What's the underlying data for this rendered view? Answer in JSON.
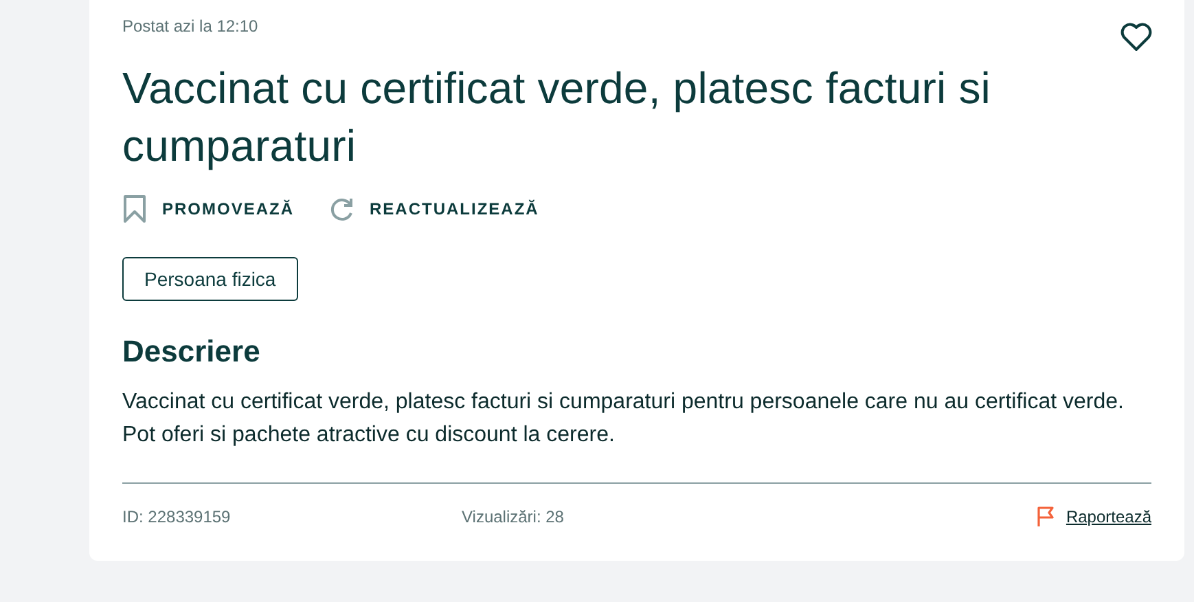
{
  "posted": "Postat azi la 12:10",
  "title": "Vaccinat cu certificat verde, platesc facturi si cumparaturi",
  "actions": [
    {
      "kind": "promote",
      "label": "PROMOVEAZĂ"
    },
    {
      "kind": "refresh",
      "label": "REACTUALIZEAZĂ"
    }
  ],
  "tag": "Persoana fizica",
  "description": {
    "heading": "Descriere",
    "text": "Vaccinat cu certificat verde, platesc facturi si cumparaturi pentru persoanele care nu au certificat verde.\nPot oferi si pachete atractive cu discount la cerere."
  },
  "footer": {
    "id": "ID: 228339159",
    "views": "Vizualizări: 28",
    "report": "Raportează"
  }
}
